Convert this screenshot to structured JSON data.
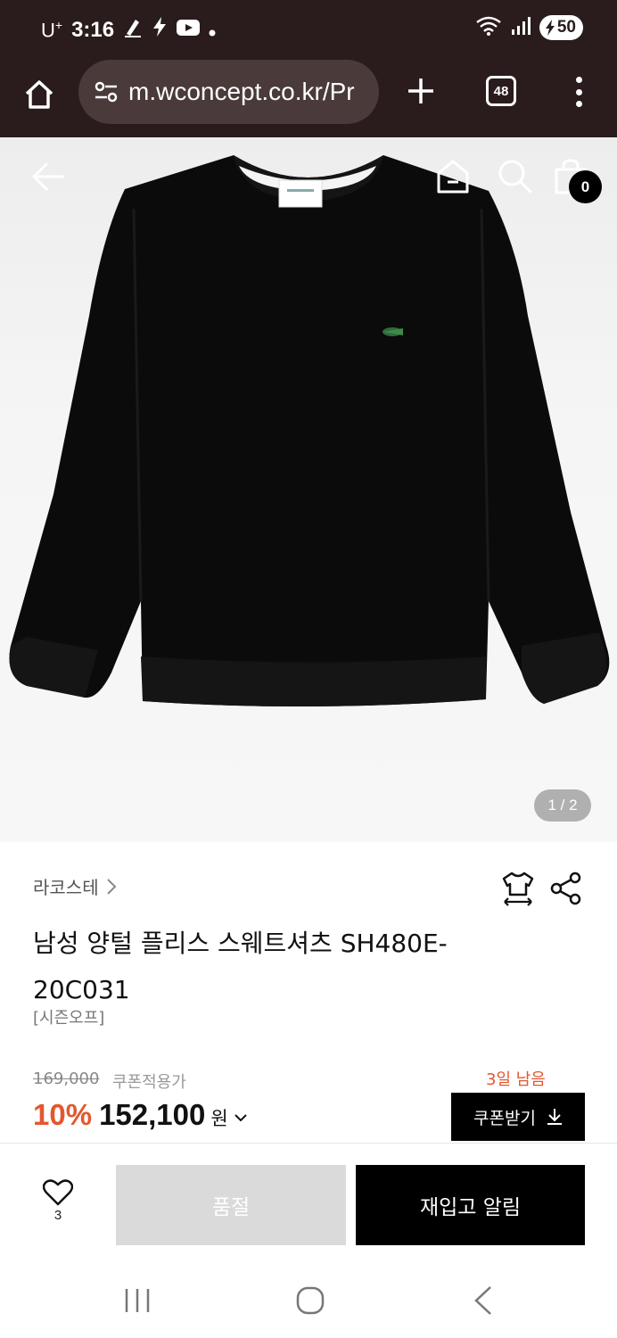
{
  "status_bar": {
    "carrier": "U",
    "carrier_sup": "+",
    "time": "3:16",
    "battery": "50"
  },
  "browser": {
    "url": "m.wconcept.co.kr/Pr",
    "tab_count": "48"
  },
  "product_image": {
    "page_counter": "1 / 2",
    "cart_count": "0"
  },
  "product": {
    "brand": "라코스테",
    "title": "남성 양털 플리스 스웨트셔츠 SH480E-20C031",
    "season_tag": "[시즌오프]",
    "original_price": "169,000",
    "coupon_note": "쿠폰적용가",
    "days_left": "3일 남음",
    "discount": "10%",
    "price": "152,100",
    "currency": "원",
    "coupon_button": "쿠폰받기"
  },
  "actions": {
    "like_count": "3",
    "soldout_label": "품절",
    "restock_label": "재입고 알림"
  }
}
